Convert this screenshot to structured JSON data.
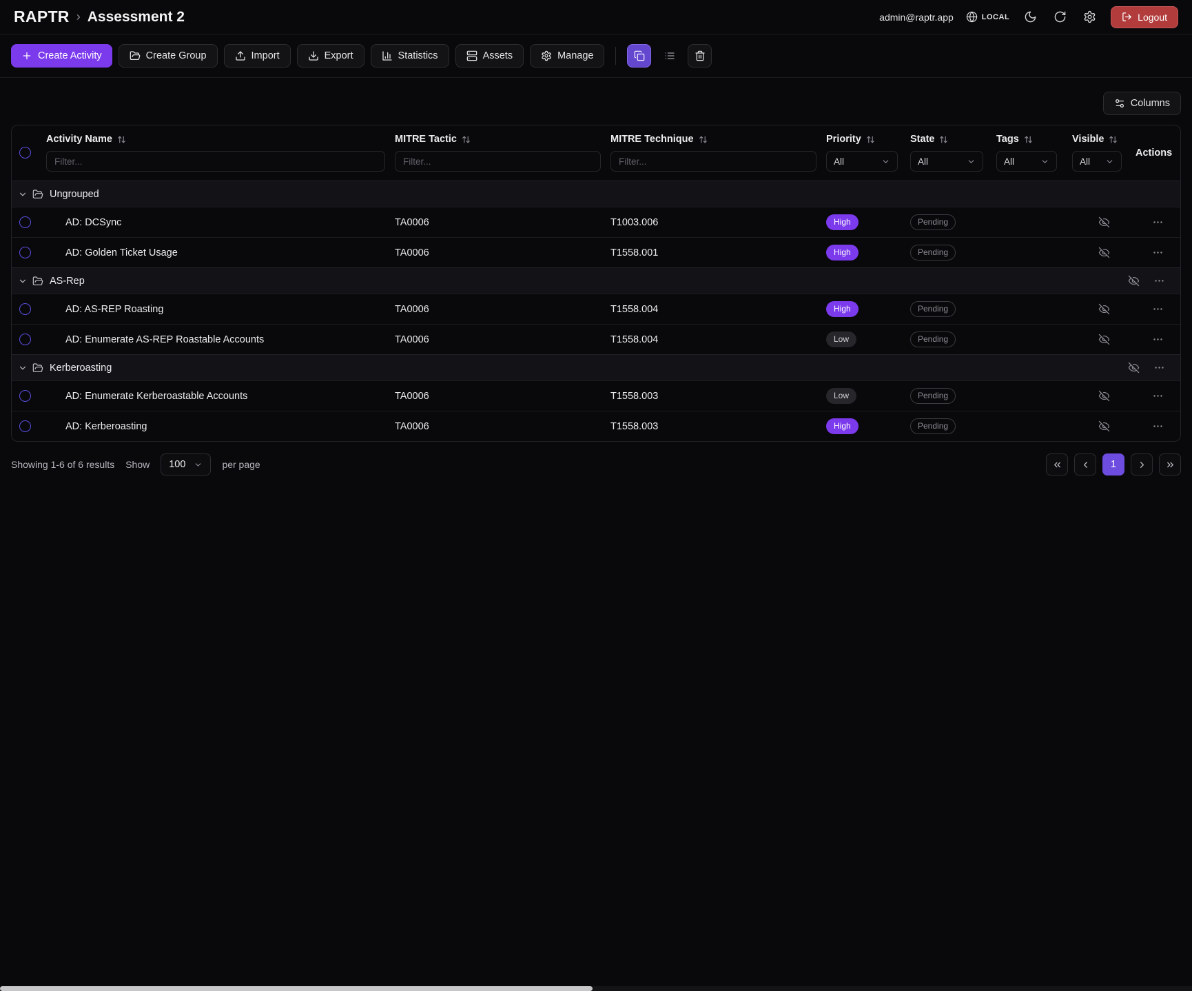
{
  "header": {
    "brand": "RAPTR",
    "separator": "›",
    "breadcrumb": "Assessment 2",
    "user_email": "admin@raptr.app",
    "env_label": "LOCAL",
    "logout_label": "Logout"
  },
  "toolbar": {
    "create_activity_label": "Create Activity",
    "create_group_label": "Create Group",
    "import_label": "Import",
    "export_label": "Export",
    "statistics_label": "Statistics",
    "assets_label": "Assets",
    "manage_label": "Manage"
  },
  "controls": {
    "columns_label": "Columns"
  },
  "table": {
    "headers": {
      "activity": "Activity Name",
      "tactic": "MITRE Tactic",
      "technique": "MITRE Technique",
      "priority": "Priority",
      "state": "State",
      "tags": "Tags",
      "visible": "Visible",
      "actions": "Actions"
    },
    "filter_placeholder": "Filter...",
    "filter_all": "All",
    "groups": [
      {
        "name": "Ungrouped",
        "rows": [
          {
            "name": "AD: DCSync",
            "tactic": "TA0006",
            "technique": "T1003.006",
            "priority": "High",
            "state": "Pending"
          },
          {
            "name": "AD: Golden Ticket Usage",
            "tactic": "TA0006",
            "technique": "T1558.001",
            "priority": "High",
            "state": "Pending"
          }
        ]
      },
      {
        "name": "AS-Rep",
        "rows": [
          {
            "name": "AD: AS-REP Roasting",
            "tactic": "TA0006",
            "technique": "T1558.004",
            "priority": "High",
            "state": "Pending"
          },
          {
            "name": "AD: Enumerate AS-REP Roastable Accounts",
            "tactic": "TA0006",
            "technique": "T1558.004",
            "priority": "Low",
            "state": "Pending"
          }
        ]
      },
      {
        "name": "Kerberoasting",
        "rows": [
          {
            "name": "AD: Enumerate Kerberoastable Accounts",
            "tactic": "TA0006",
            "technique": "T1558.003",
            "priority": "Low",
            "state": "Pending"
          },
          {
            "name": "AD: Kerberoasting",
            "tactic": "TA0006",
            "technique": "T1558.003",
            "priority": "High",
            "state": "Pending"
          }
        ]
      }
    ]
  },
  "footer": {
    "showing_text": "Showing 1-6 of 6 results",
    "show_label": "Show",
    "page_size": "100",
    "per_page_label": "per page",
    "current_page": "1"
  },
  "colors": {
    "accent_purple": "#7c3aed",
    "high_badge": "#7c3aed",
    "low_badge": "#26262b",
    "pending_border": "#3a3a41",
    "logout_red": "#b23c3c",
    "background": "#09090b"
  }
}
